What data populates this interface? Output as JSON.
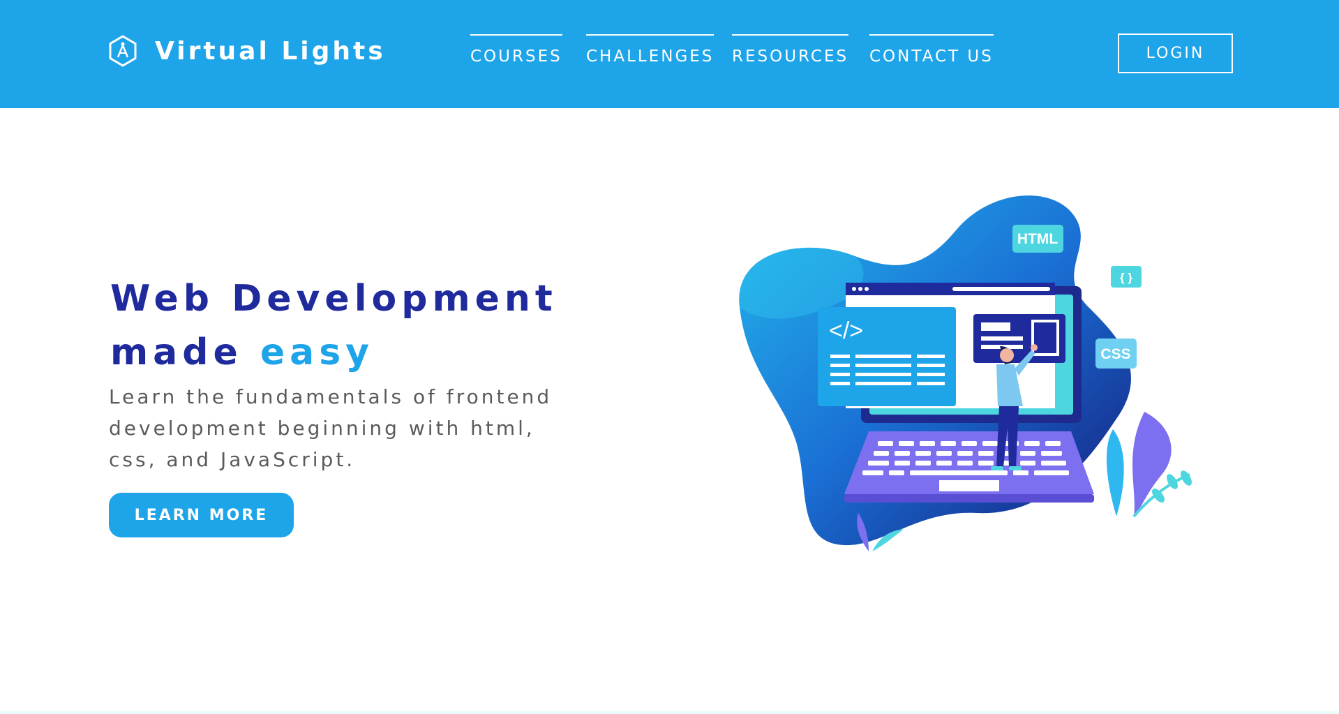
{
  "brand": {
    "name": "Virtual Lights",
    "logo_icon": "hexagon-compass-logo"
  },
  "nav": {
    "items": [
      {
        "label": "COURSES"
      },
      {
        "label": "CHALLENGES"
      },
      {
        "label": "RESOURCES"
      },
      {
        "label": "CONTACT US"
      }
    ],
    "login_label": "LOGIN"
  },
  "hero": {
    "title_line1": "Web Development",
    "title_line2_prefix": "made",
    "title_line2_accent": "easy",
    "description": "Learn the fundamentals of frontend development beginning with html, css, and JavaScript.",
    "cta_label": "LEARN MORE"
  },
  "illustration": {
    "tags": [
      "HTML",
      "{ }",
      "CSS"
    ],
    "code_symbol": "</>"
  },
  "colors": {
    "header_bg": "#1ea4e9",
    "title_dark": "#1f2a9c",
    "accent": "#1ea4e9",
    "text_gray": "#5a5a5a"
  }
}
